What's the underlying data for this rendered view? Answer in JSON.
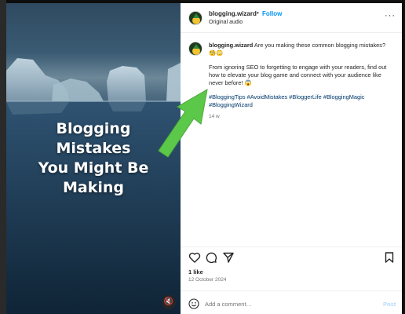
{
  "post": {
    "username": "blogging.wizard",
    "separator": "•",
    "follow_label": "Follow",
    "audio_label": "Original audio",
    "more_label": "···"
  },
  "media": {
    "overlay_lines": [
      "Blogging",
      "Mistakes",
      "You Might Be",
      "Making"
    ]
  },
  "caption": {
    "username": "blogging.wizard",
    "text": "Are you making these common blogging mistakes? 🧐😳",
    "body": "From ignoring SEO to forgetting to engage with your readers, find out how to elevate your blog game and connect with your audience like never before! 😱",
    "hashtags": "#BloggingTips #AvoidMistakes #BloggerLife #BloggingMagic #BloggingWizard",
    "time_ago": "14 w"
  },
  "stats": {
    "likes": "1 like",
    "date": "12 October 2024"
  },
  "comment": {
    "placeholder": "Add a comment…",
    "post_label": "Post"
  },
  "colors": {
    "accent": "#0095f6",
    "hashtag": "#00376b",
    "arrow": "#5cc84a"
  }
}
